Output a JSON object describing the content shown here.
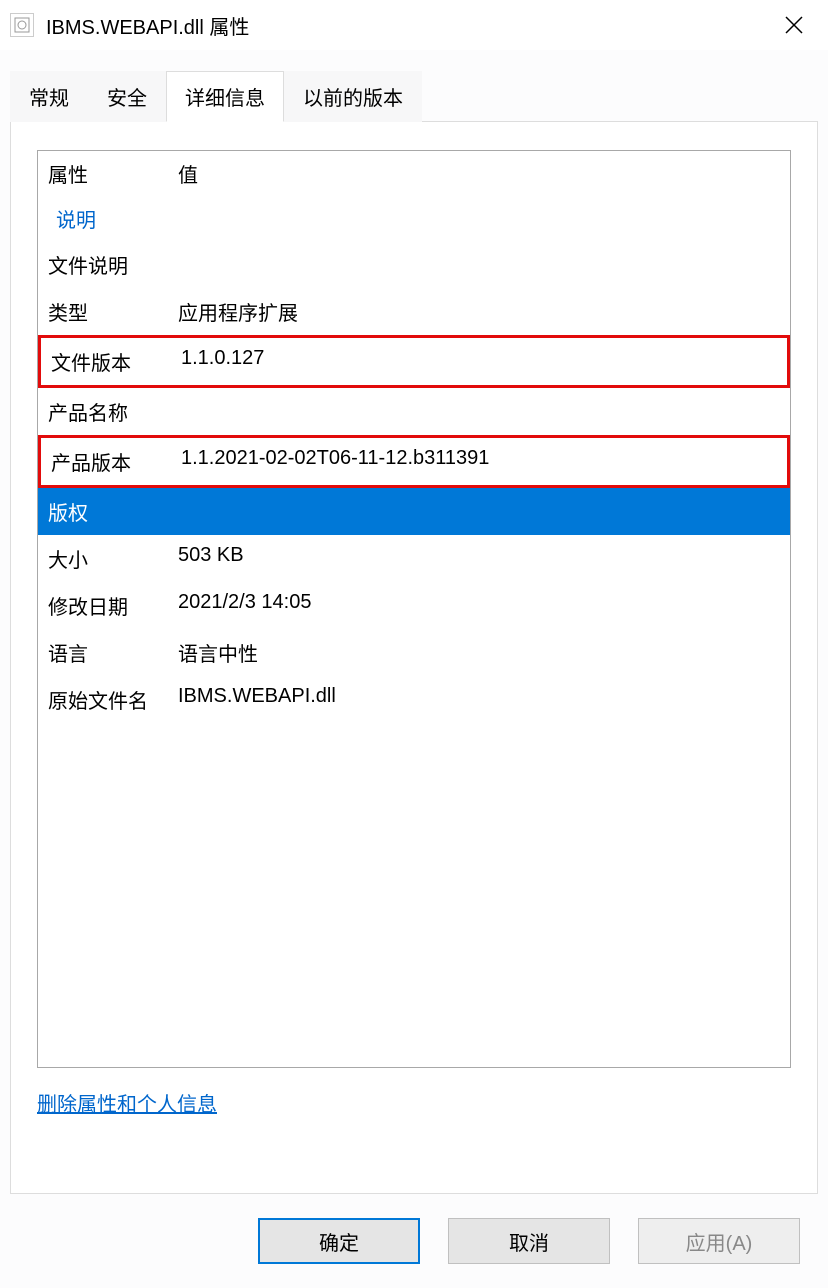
{
  "titlebar": {
    "title": "IBMS.WEBAPI.dll 属性"
  },
  "tabs": [
    {
      "label": "常规",
      "active": false
    },
    {
      "label": "安全",
      "active": false
    },
    {
      "label": "详细信息",
      "active": true
    },
    {
      "label": "以前的版本",
      "active": false
    }
  ],
  "grid": {
    "header_property": "属性",
    "header_value": "值",
    "section_label": "说明",
    "rows": [
      {
        "label": "文件说明",
        "value": ""
      },
      {
        "label": "类型",
        "value": "应用程序扩展"
      },
      {
        "label": "文件版本",
        "value": "1.1.0.127",
        "highlight": true
      },
      {
        "label": "产品名称",
        "value": ""
      },
      {
        "label": "产品版本",
        "value": "1.1.2021-02-02T06-11-12.b311391",
        "highlight": true
      },
      {
        "label": "版权",
        "value": "",
        "selected": true
      },
      {
        "label": "大小",
        "value": "503 KB"
      },
      {
        "label": "修改日期",
        "value": "2021/2/3 14:05"
      },
      {
        "label": "语言",
        "value": "语言中性"
      },
      {
        "label": "原始文件名",
        "value": "IBMS.WEBAPI.dll"
      }
    ]
  },
  "remove_link": "删除属性和个人信息",
  "buttons": {
    "ok": "确定",
    "cancel": "取消",
    "apply": "应用(A)"
  }
}
